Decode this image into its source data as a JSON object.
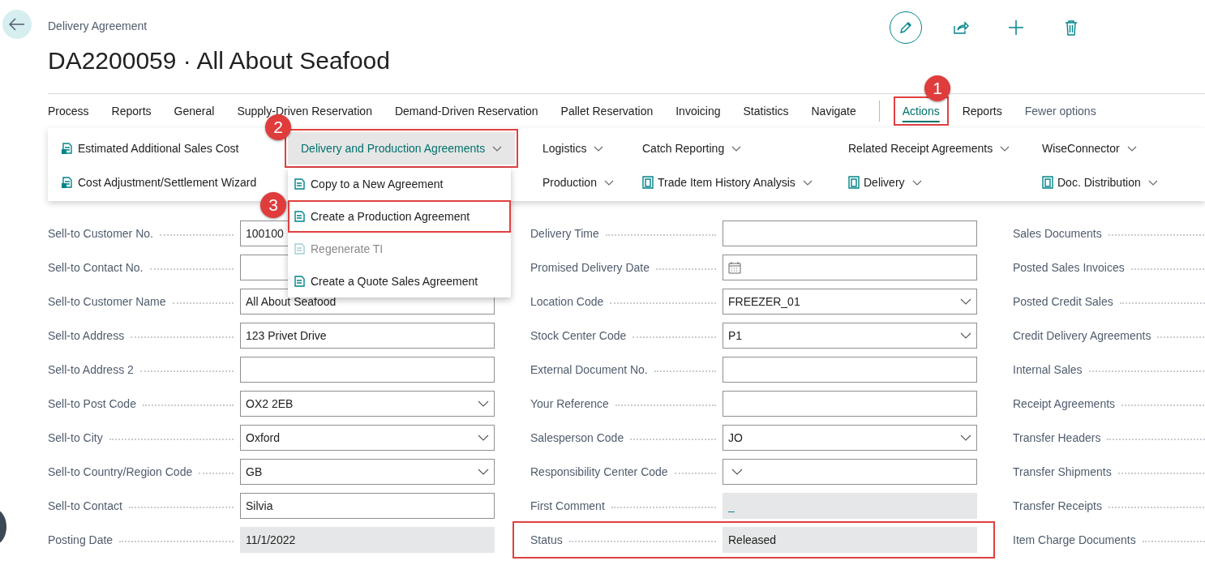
{
  "page": {
    "caption": "Delivery Agreement",
    "title": "DA2200059 · All About Seafood"
  },
  "tabs": [
    {
      "kind": "tab",
      "label": "Process",
      "selected": false
    },
    {
      "kind": "tab",
      "label": "Reports",
      "selected": false
    },
    {
      "kind": "tab",
      "label": "General",
      "selected": false
    },
    {
      "kind": "tab",
      "label": "Supply-Driven Reservation",
      "selected": false
    },
    {
      "kind": "tab",
      "label": "Demand-Driven Reservation",
      "selected": false
    },
    {
      "kind": "tab",
      "label": "Pallet Reservation",
      "selected": false
    },
    {
      "kind": "tab",
      "label": "Invoicing",
      "selected": false
    },
    {
      "kind": "tab",
      "label": "Statistics",
      "selected": false
    },
    {
      "kind": "tab",
      "label": "Navigate",
      "selected": false
    },
    {
      "kind": "separator"
    },
    {
      "kind": "tab",
      "label": "Actions",
      "selected": true,
      "highlighted": true,
      "callout": "1"
    },
    {
      "kind": "tab",
      "label": "Reports",
      "selected": false
    },
    {
      "kind": "link",
      "label": "Fewer options"
    }
  ],
  "actions": [
    [
      {
        "kind": "command",
        "label": "Estimated Additional Sales Cost"
      },
      {
        "kind": "command",
        "label": "Cost Adjustment/Settlement Wizard"
      }
    ],
    [
      {
        "kind": "group",
        "label": "Delivery and Production Agreements",
        "expanded": true,
        "highlighted": true,
        "callout": "2",
        "menu": [
          {
            "label": "Copy to a New Agreement",
            "disabled": false,
            "highlighted": false
          },
          {
            "label": "Create a Production Agreement",
            "disabled": false,
            "highlighted": true,
            "callout": "3"
          },
          {
            "label": "Regenerate TI",
            "disabled": true,
            "highlighted": false
          },
          {
            "label": "Create a Quote Sales Agreement",
            "disabled": false,
            "highlighted": false
          }
        ]
      }
    ],
    [
      {
        "kind": "group",
        "label": "Logistics",
        "expanded": false
      },
      {
        "kind": "group",
        "label": "Production",
        "expanded": false
      }
    ],
    [
      {
        "kind": "group",
        "label": "Catch Reporting",
        "expanded": false
      },
      {
        "kind": "icon-group",
        "label": "Trade Item History Analysis",
        "expanded": false
      }
    ],
    [
      {
        "kind": "group",
        "label": "Related Receipt Agreements",
        "expanded": false
      },
      {
        "kind": "icon-group",
        "label": "Delivery",
        "expanded": false
      }
    ],
    [
      {
        "kind": "group",
        "label": "WiseConnector",
        "expanded": false
      },
      {
        "kind": "icon-group",
        "label": "Doc. Distribution",
        "expanded": false
      }
    ]
  ],
  "form_left": [
    {
      "label": "Sell-to Customer No.",
      "kind": "text",
      "value": "100100"
    },
    {
      "label": "Sell-to Contact No.",
      "kind": "text"
    },
    {
      "label": "Sell-to Customer Name",
      "kind": "text",
      "value": "All About Seafood"
    },
    {
      "label": "Sell-to Address",
      "kind": "text",
      "value": "123 Privet Drive"
    },
    {
      "label": "Sell-to Address 2",
      "kind": "text"
    },
    {
      "label": "Sell-to Post Code",
      "kind": "dropdown",
      "value": "OX2 2EB"
    },
    {
      "label": "Sell-to City",
      "kind": "dropdown",
      "value": "Oxford"
    },
    {
      "label": "Sell-to Country/Region Code",
      "kind": "dropdown",
      "value": "GB"
    },
    {
      "label": "Sell-to Contact",
      "kind": "text",
      "value": "Silvia"
    },
    {
      "label": "Posting Date",
      "kind": "readonly",
      "value": "11/1/2022"
    }
  ],
  "form_middle": [
    {
      "label": "Delivery Time",
      "kind": "text"
    },
    {
      "label": "Promised Delivery Date",
      "kind": "date"
    },
    {
      "label": "Location Code",
      "kind": "dropdown",
      "value": "FREEZER_01"
    },
    {
      "label": "Stock Center Code",
      "kind": "dropdown",
      "value": "P1"
    },
    {
      "label": "External Document No.",
      "kind": "text"
    },
    {
      "label": "Your Reference",
      "kind": "text"
    },
    {
      "label": "Salesperson Code",
      "kind": "dropdown",
      "value": "JO"
    },
    {
      "label": "Responsibility Center Code",
      "kind": "dropdown"
    },
    {
      "label": "First Comment",
      "kind": "readonly-link",
      "value": "_"
    },
    {
      "label": "Status",
      "kind": "readonly",
      "value": "Released",
      "highlighted": true
    }
  ],
  "related": [
    "Sales Documents",
    "Posted Sales Invoices",
    "Posted Credit Sales",
    "Credit Delivery Agreements",
    "Internal Sales",
    "Receipt Agreements",
    "Transfer Headers",
    "Transfer Shipments",
    "Transfer Receipts",
    "Item Charge Documents"
  ]
}
